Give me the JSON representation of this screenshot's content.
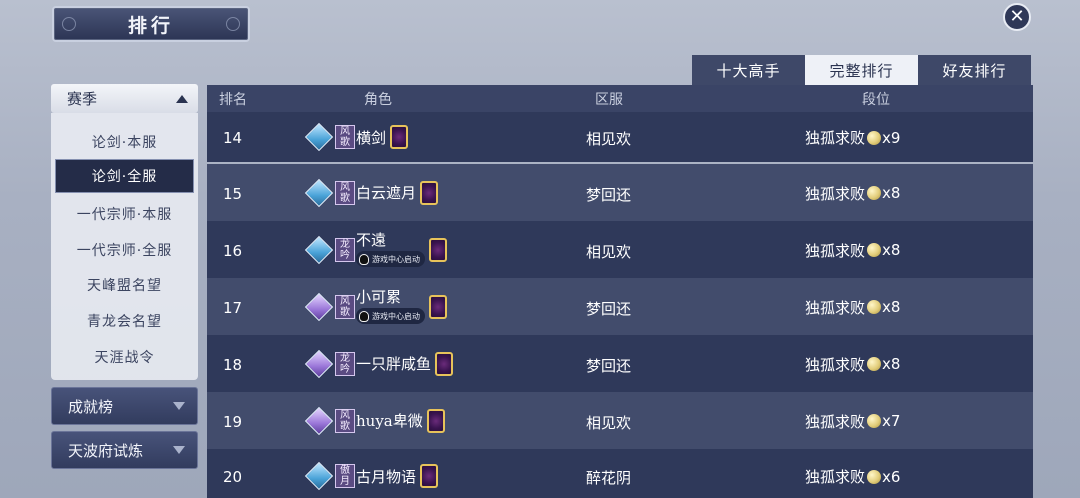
{
  "header": {
    "title": "排行"
  },
  "tabs": [
    {
      "label": "十大高手",
      "active": false
    },
    {
      "label": "完整排行",
      "active": true
    },
    {
      "label": "好友排行",
      "active": false
    }
  ],
  "sidebar": {
    "season_label": "赛季",
    "season_items": [
      {
        "label": "论剑·本服",
        "active": false
      },
      {
        "label": "论剑·全服",
        "active": true
      },
      {
        "label": "一代宗师·本服",
        "active": false
      },
      {
        "label": "一代宗师·全服",
        "active": false
      },
      {
        "label": "天峰盟名望",
        "active": false
      },
      {
        "label": "青龙会名望",
        "active": false
      },
      {
        "label": "天涯战令",
        "active": false
      }
    ],
    "collapsed": [
      {
        "label": "成就榜"
      },
      {
        "label": "天波府试炼"
      }
    ]
  },
  "table": {
    "columns": [
      "排名",
      "角色",
      "区服",
      "段位"
    ],
    "rows": [
      {
        "rank": "14",
        "gem": "blue",
        "sect": [
          "风",
          "歌"
        ],
        "name": "横剑",
        "qq": "",
        "server": "相见欢",
        "tier": "独孤求败",
        "mult": "x9"
      },
      {
        "rank": "15",
        "gem": "blue",
        "sect": [
          "风",
          "歌"
        ],
        "name": "白云遮月",
        "qq": "",
        "server": "梦回还",
        "tier": "独孤求败",
        "mult": "x8"
      },
      {
        "rank": "16",
        "gem": "blue",
        "sect": [
          "龙",
          "吟"
        ],
        "name": "不遠",
        "qq": "游戏中心启动",
        "server": "相见欢",
        "tier": "独孤求败",
        "mult": "x8"
      },
      {
        "rank": "17",
        "gem": "purple",
        "sect": [
          "风",
          "歌"
        ],
        "name": "小可累",
        "qq": "游戏中心启动",
        "server": "梦回还",
        "tier": "独孤求败",
        "mult": "x8"
      },
      {
        "rank": "18",
        "gem": "purple",
        "sect": [
          "龙",
          "吟"
        ],
        "name": "一只胖咸鱼",
        "qq": "",
        "server": "梦回还",
        "tier": "独孤求败",
        "mult": "x8"
      },
      {
        "rank": "19",
        "gem": "purple",
        "sect": [
          "风",
          "歌"
        ],
        "name": "huya卑微",
        "qq": "",
        "server": "相见欢",
        "tier": "独孤求败",
        "mult": "x7"
      },
      {
        "rank": "20",
        "gem": "blue",
        "sect": [
          "傲",
          "月"
        ],
        "name": "古月物语",
        "qq": "",
        "server": "醉花阴",
        "tier": "独孤求败",
        "mult": "x6"
      }
    ]
  },
  "colors": {
    "accent_dark": "#2f395a",
    "accent_light": "#424c6c",
    "tab_active": "#eef1f7"
  }
}
